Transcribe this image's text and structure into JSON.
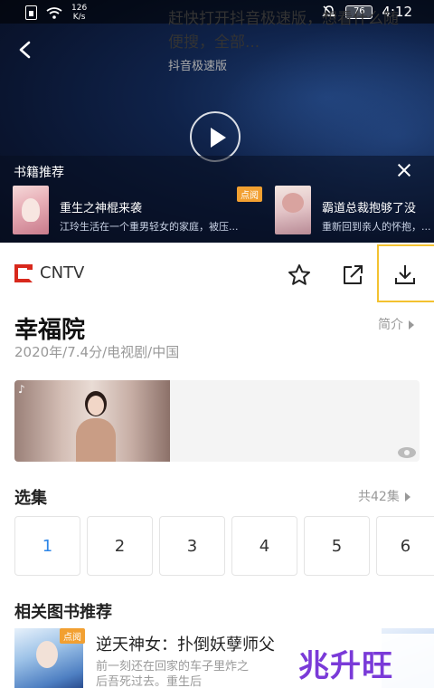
{
  "status_bar": {
    "net_speed_value": "126",
    "net_speed_unit": "K/s",
    "battery": "76",
    "time": "4:12"
  },
  "video": {
    "section_title": "书籍推荐",
    "books": [
      {
        "title": "重生之神棍来袭",
        "desc": "江玲生活在一个重男轻女的家庭，被压...",
        "tag": "点阅"
      },
      {
        "title": "霸道总裁抱够了没",
        "desc": "重新回到亲人的怀抱，..."
      }
    ]
  },
  "toolbar": {
    "source": "CNTV"
  },
  "show": {
    "title": "幸福院",
    "meta": "2020年/7.4分/电视剧/中国",
    "intro_label": "简介"
  },
  "ad": {
    "text": "赶快打开抖音极速版，想看什么随便搜，全部...",
    "source": "抖音极速版"
  },
  "episodes": {
    "section_title": "选集",
    "count_label": "共42集",
    "items": [
      "1",
      "2",
      "3",
      "4",
      "5",
      "6"
    ],
    "active_index": 0,
    "active_color": "#2d86e8"
  },
  "related": {
    "section_title": "相关图书推荐",
    "book": {
      "tag": "点阅",
      "title": "逆天神女：扑倒妖孽师父",
      "desc": "前一刻还在回家的车子里炸之后吾死过去。重生后"
    }
  },
  "watermark": "兆升旺",
  "colors": {
    "cntv_red": "#d8281c",
    "focus_yellow": "#f3c230",
    "tag_orange": "#f2a031"
  }
}
